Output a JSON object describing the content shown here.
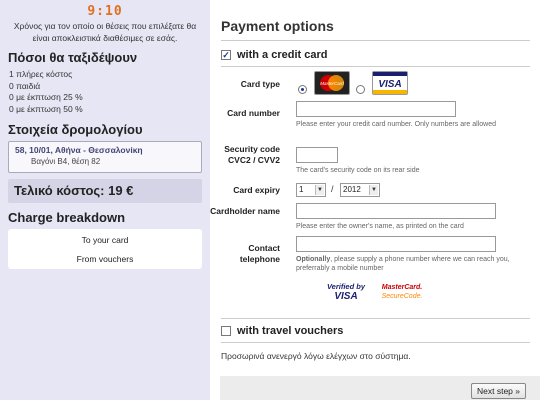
{
  "timer": {
    "value": "9:10",
    "note": "Χρόνος για τον οποίο οι θέσεις που επιλέξατε θα είναι αποκλειστικά διαθέσιμες σε εσάς."
  },
  "passengers": {
    "title": "Πόσοι θα ταξιδέψουν",
    "lines": [
      "1 πλήρες κόστος",
      "0 παιδιά",
      "0 με έκπτωση 25 %",
      "0 με έκπτωση 50 %"
    ]
  },
  "route": {
    "title": "Στοιχεία δρομολογίου",
    "line1": "58, 10/01, Αθήνα - Θεσσαλονίκη",
    "line2": "Βαγόνι Β4, θέση 82"
  },
  "total": {
    "label": "Τελικό κόστος: 19 €"
  },
  "charge": {
    "title": "Charge breakdown",
    "to_card": "To your card",
    "from_vouchers": "From vouchers"
  },
  "payment": {
    "title": "Payment options",
    "credit_card_label": "with a credit card",
    "credit_card_checked": true,
    "card_type_label": "Card type",
    "card_types": [
      "MasterCard",
      "VISA"
    ],
    "card_type_selected": "MasterCard",
    "card_number_label": "Card number",
    "card_number_hint": "Please enter your credit card number. Only numbers are allowed",
    "cvc_label": "Security code CVC2 / CVV2",
    "cvc_hint": "The card's security code on its rear side",
    "expiry_label": "Card expiry",
    "expiry_month": "1",
    "expiry_sep": "/",
    "expiry_year": "2012",
    "holder_label": "Cardholder name",
    "holder_hint": "Please enter the owner's name, as printed on the card",
    "phone_label": "Contact telephone",
    "phone_hint_bold": "Optionally",
    "phone_hint": ", please supply a phone number where we can reach you, preferrably a mobile number",
    "verified_line1": "Verified by",
    "verified_line2": "VISA",
    "securecode_line1": "MasterCard.",
    "securecode_line2": "SecureCode.",
    "vouchers_label": "with travel vouchers",
    "vouchers_checked": false,
    "vouchers_note": "Προσωρινά ανενεργό λόγω ελέγχων στο σύστημα.",
    "next_button": "Next step »"
  },
  "colors": {
    "timer": "#e07020",
    "left_panel": "#e6e6f5",
    "route_text": "#444477",
    "mastercard_red": "#cc0000",
    "mastercard_orange": "#ff9900",
    "visa_blue": "#1a1f71"
  }
}
